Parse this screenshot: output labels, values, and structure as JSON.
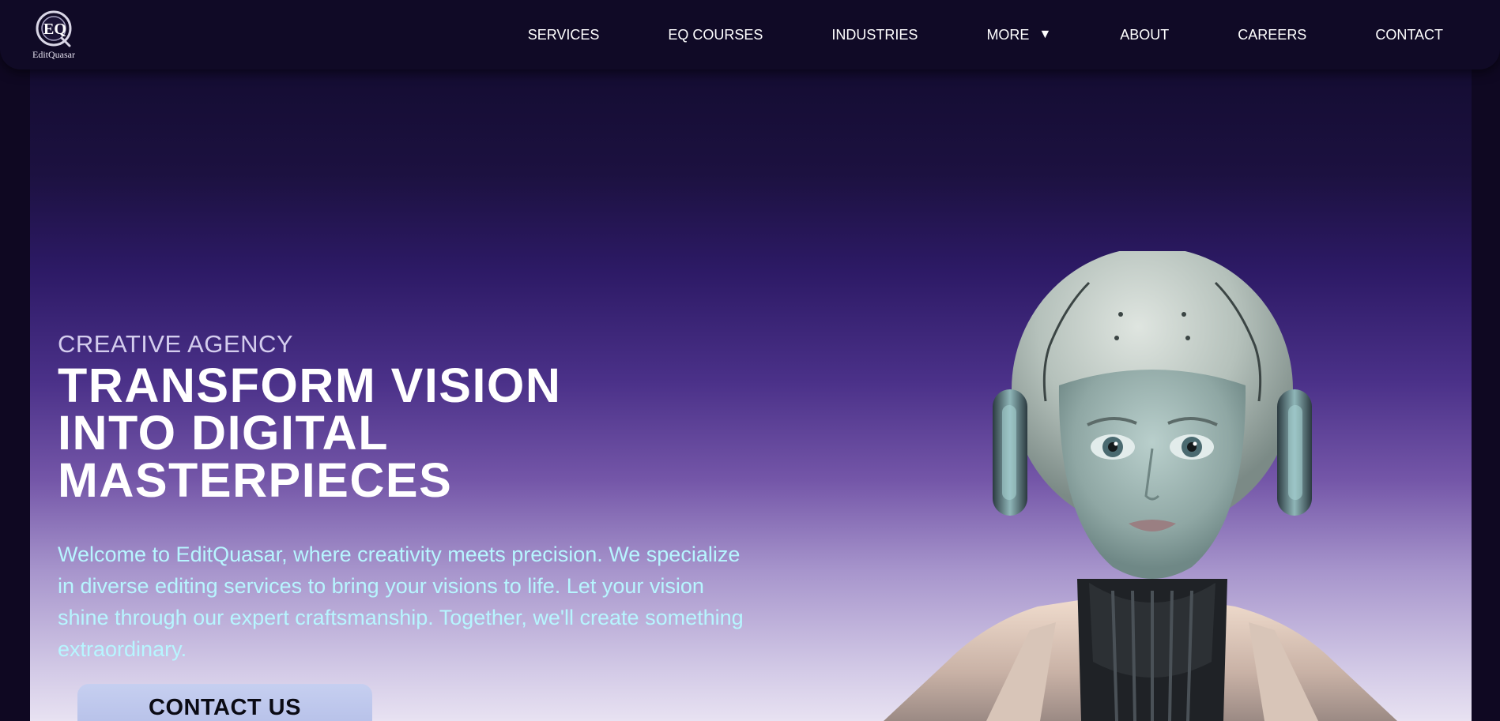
{
  "brand": {
    "logo_text": "EditQuasar",
    "logo_icon": "eq-monogram-icon"
  },
  "nav": {
    "items": [
      {
        "label": "SERVICES"
      },
      {
        "label": "EQ COURSES"
      },
      {
        "label": "INDUSTRIES"
      },
      {
        "label": "MORE",
        "icon": "caret-down-icon"
      },
      {
        "label": "ABOUT"
      },
      {
        "label": "CAREERS"
      },
      {
        "label": "CONTACT"
      }
    ],
    "more_caret": "▼"
  },
  "hero": {
    "eyebrow": "CREATIVE AGENCY",
    "headline_lines": [
      "TRANSFORM VISION",
      "INTO DIGITAL",
      "MASTERPIECES"
    ],
    "intro": "Welcome to EditQuasar, where creativity meets precision. We specialize in diverse editing services to bring your visions to life. Let your vision shine through our expert craftsmanship. Together, we'll create something extraordinary.",
    "cta_label": "CONTACT US",
    "illustration": "robot-woman-illustration"
  },
  "colors": {
    "nav_bg": "#100a26",
    "hero_top": "#140c32",
    "hero_mid": "#4b3189",
    "hero_bottom": "#e8e2f2",
    "intro_text": "#b7f6ff",
    "cta_bg": "#c6cff0"
  }
}
